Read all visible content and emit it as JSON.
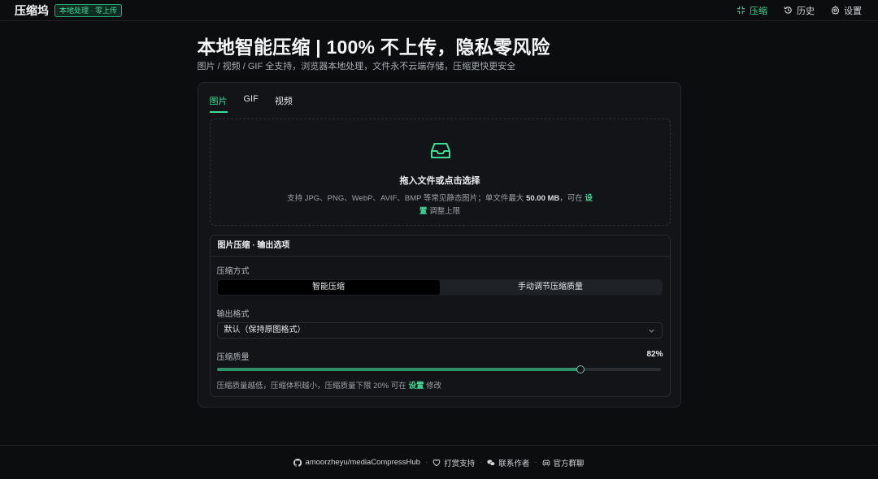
{
  "header": {
    "brand": "压缩坞",
    "badge": "本地处理 · 零上传",
    "nav": [
      {
        "label": "压缩",
        "icon": "compress-icon",
        "active": true
      },
      {
        "label": "历史",
        "icon": "history-icon",
        "active": false
      },
      {
        "label": "设置",
        "icon": "gear-icon",
        "active": false
      }
    ]
  },
  "hero": {
    "title": "本地智能压缩 | 100% 不上传，隐私零风险",
    "subtitle": "图片 / 视频 / GIF 全支持，浏览器本地处理，文件永不云端存储，压缩更快更安全"
  },
  "tabs": [
    {
      "label": "图片",
      "active": true
    },
    {
      "label": "GIF",
      "active": false
    },
    {
      "label": "视频",
      "active": false
    }
  ],
  "dropzone": {
    "icon": "inbox-icon",
    "title": "拖入文件或点击选择",
    "desc_prefix": "支持 JPG、PNG、WebP、AVIF、BMP 等常见静态图片；单文件最大 ",
    "max_size": "50.00 MB",
    "desc_mid": "，可在 ",
    "settings_link": "设置",
    "desc_suffix": " 调整上限"
  },
  "options": {
    "title": "图片压缩 · 输出选项",
    "method_label": "压缩方式",
    "method_options": [
      "智能压缩",
      "手动调节压缩质量"
    ],
    "method_selected": "智能压缩",
    "format_label": "输出格式",
    "format_value": "默认（保持原图格式）",
    "quality_label": "压缩质量",
    "quality_value": "82%",
    "quality_fraction": 0.82,
    "hint_prefix": "压缩质量越低，压缩体积越小，压缩质量下限 20% 可在 ",
    "hint_link": "设置",
    "hint_suffix": " 修改"
  },
  "footer": {
    "repo": "amoorzheyu/mediaCompressHub",
    "support": "打赏支持",
    "contact": "联系作者",
    "group": "官方群聊"
  },
  "colors": {
    "accent": "#3ddc97",
    "background": "#0c0d0f",
    "card": "#121417"
  }
}
